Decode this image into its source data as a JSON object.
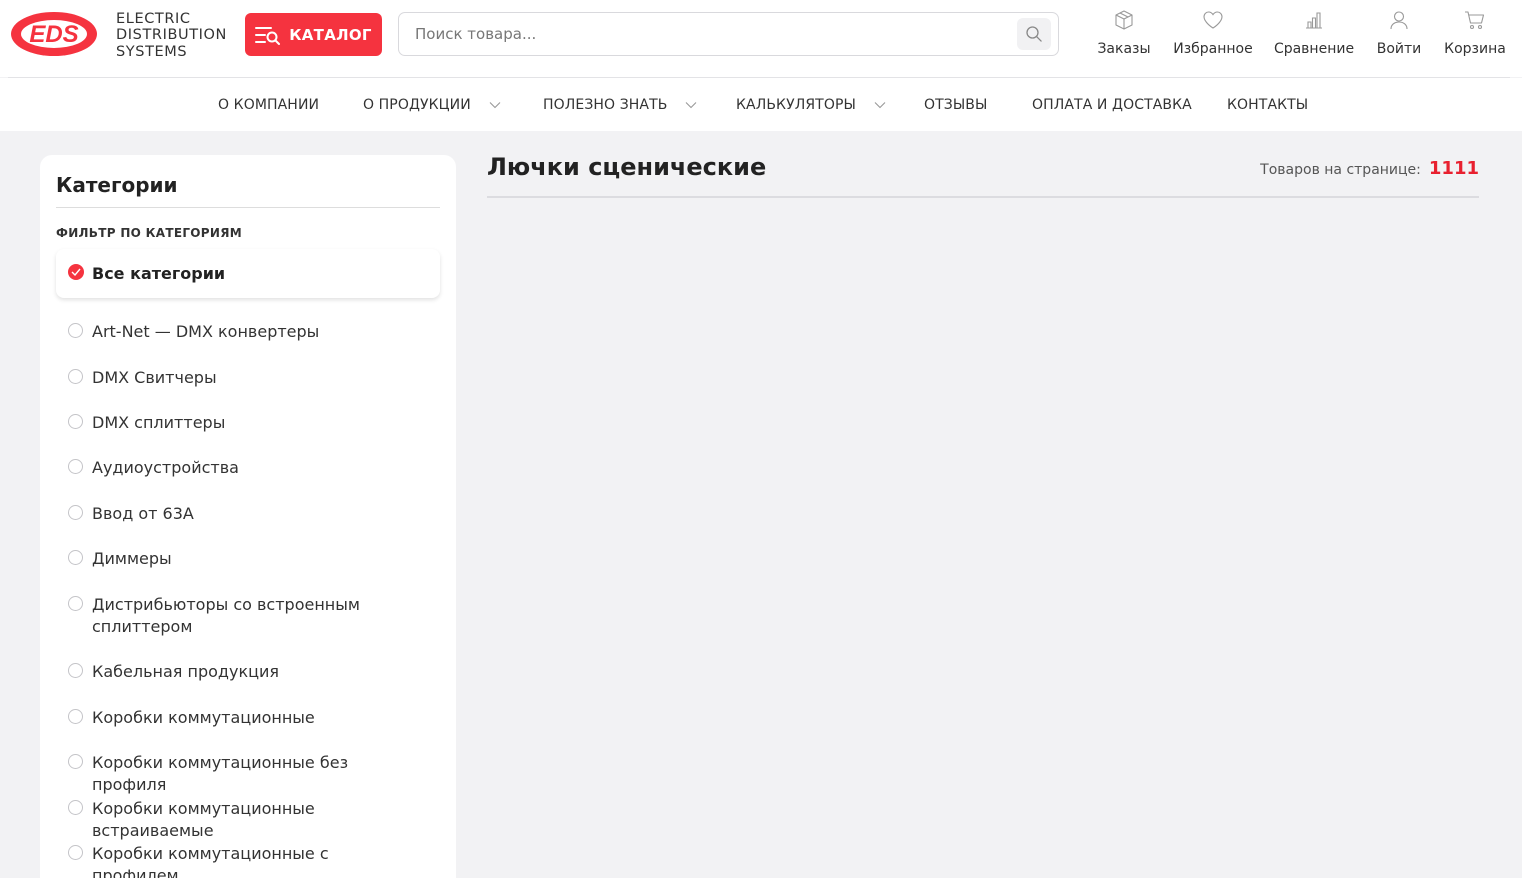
{
  "brand": {
    "logo_text": "EDS",
    "name_lines": [
      "ELECTRIC",
      "DISTRIBUTION",
      "SYSTEMS"
    ]
  },
  "header": {
    "catalog_label": "КАТАЛОГ",
    "search_placeholder": "Поиск товара...",
    "actions": {
      "orders": "Заказы",
      "favorites": "Избранное",
      "compare": "Сравнение",
      "login": "Войти",
      "cart": "Корзина"
    }
  },
  "nav": {
    "items": [
      {
        "label": "О КОМПАНИИ",
        "has_dropdown": false
      },
      {
        "label": "О ПРОДУКЦИИ",
        "has_dropdown": true
      },
      {
        "label": "ПОЛЕЗНО ЗНАТЬ",
        "has_dropdown": true
      },
      {
        "label": "КАЛЬКУЛЯТОРЫ",
        "has_dropdown": true
      },
      {
        "label": "ОТЗЫВЫ",
        "has_dropdown": false
      },
      {
        "label": "ОПЛАТА И ДОСТАВКА",
        "has_dropdown": false
      },
      {
        "label": "КОНТАКТЫ",
        "has_dropdown": false
      }
    ]
  },
  "sidebar": {
    "title": "Категории",
    "filter_label": "ФИЛЬТР ПО КАТЕГОРИЯМ",
    "all_label": "Все категории",
    "categories": [
      "Art-Net — DMX конвертеры",
      "DMX Свитчеры",
      "DMX сплиттеры",
      "Аудиоустройства",
      "Ввод от 63А",
      "Диммеры",
      "Дистрибьюторы со встроенным сплиттером",
      "Кабельная продукция",
      "Коробки коммутационные",
      "Коробки коммутационные без профиля",
      "Коробки коммутационные встраиваемые",
      "Коробки коммутационные с профилем"
    ]
  },
  "main": {
    "title": "Лючки сценические",
    "per_page_label": "Товаров на странице:",
    "per_page_value": "1111"
  },
  "colors": {
    "accent": "#f5333f",
    "count_red": "#e8202f",
    "page_bg": "#f2f2f4"
  },
  "icons": {
    "orders": "box-icon",
    "favorites": "heart-icon",
    "compare": "bar-chart-icon",
    "login": "user-icon",
    "cart": "cart-icon",
    "search": "search-icon",
    "catalog": "menu-search-icon"
  }
}
